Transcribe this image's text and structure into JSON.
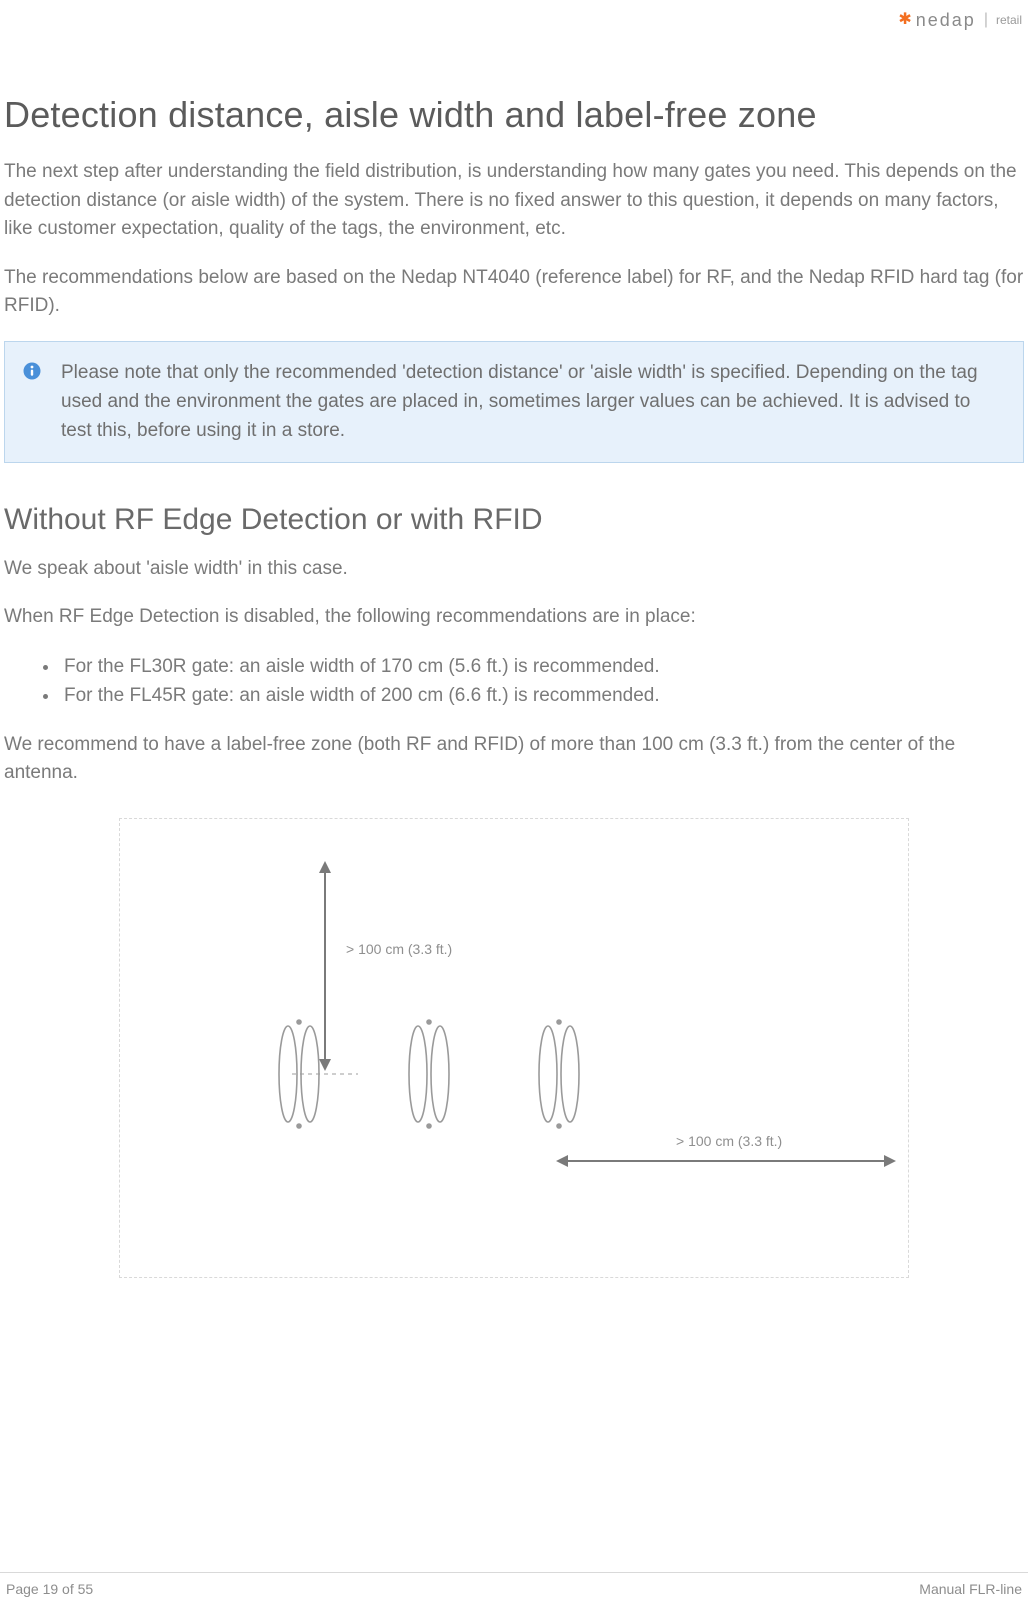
{
  "brand": {
    "star": "✱",
    "name": "nedap",
    "separator": "|",
    "sub": "retail"
  },
  "main": {
    "title": "Detection distance, aisle width and label-free zone",
    "para1": "The next step after understanding the field distribution, is understanding how many gates you need. This depends on the detection distance (or aisle width) of the system. There is no fixed answer to this question, it depends on many factors, like customer expectation, quality of the tags, the environment, etc.",
    "para2": "The recommendations below are based on the Nedap NT4040 (reference label) for RF, and the Nedap RFID hard tag (for RFID)."
  },
  "infobox": {
    "icon": "info-icon",
    "text": "Please note that only the recommended 'detection distance' or 'aisle width' is specified. Depending on the tag used and the environment the gates are placed in, sometimes larger values can be achieved. It is advised to test this, before using it in a store."
  },
  "section2": {
    "title": "Without RF Edge Detection or with RFID",
    "para1": "We speak about 'aisle width' in this case.",
    "para2": "When RF Edge Detection is disabled, the following recommendations are in place:",
    "bullets": [
      "For the FL30R gate: an aisle width of 170 cm (5.6 ft.) is recommended.",
      "For the FL45R gate: an aisle width of 200 cm (6.6 ft.) is recommended."
    ],
    "para3": "We recommend to have a label-free zone (both RF and RFID) of more than 100 cm (3.3 ft.) from the center of the antenna."
  },
  "diagram": {
    "top_label": "> 100 cm (3.3 ft.)",
    "right_label": "> 100 cm (3.3 ft.)"
  },
  "footer": {
    "left": "Page 19 of 55",
    "right": "Manual FLR-line"
  }
}
